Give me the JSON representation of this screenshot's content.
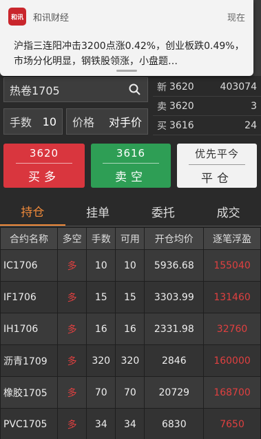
{
  "notification": {
    "app_name": "和讯财经",
    "time": "现在",
    "logo_text": "和讯",
    "body": "沪指三连阳冲击3200点涨0.42%，创业板跌0.49%，市场分化明显，钢铁股领涨，小盘题…"
  },
  "order": {
    "contract": "热卷1705",
    "qty_label": "手数",
    "qty_value": "10",
    "price_label": "价格",
    "price_value": "对手价"
  },
  "quote": {
    "rows": [
      {
        "key": "新",
        "price": "3620",
        "num": "403074"
      },
      {
        "key": "卖",
        "price": "3620",
        "num": "3"
      },
      {
        "key": "买",
        "price": "3616",
        "num": "24"
      }
    ]
  },
  "buttons": {
    "buy_price": "3620",
    "buy_label": "买多",
    "sell_price": "3616",
    "sell_label": "卖空",
    "close_top": "优先平今",
    "close_label": "平仓"
  },
  "tabs": [
    "持仓",
    "挂单",
    "委托",
    "成交"
  ],
  "table": {
    "headers": [
      "合约名称",
      "多空",
      "手数",
      "可用",
      "开仓均价",
      "逐笔浮盈"
    ],
    "rows": [
      [
        "IC1706",
        "多",
        "10",
        "10",
        "5936.68",
        "155040"
      ],
      [
        "IF1706",
        "多",
        "15",
        "15",
        "3303.99",
        "131460"
      ],
      [
        "IH1706",
        "多",
        "16",
        "16",
        "2331.98",
        "32760"
      ],
      [
        "沥青1709",
        "多",
        "320",
        "320",
        "2846",
        "160000"
      ],
      [
        "橡胶1705",
        "多",
        "70",
        "70",
        "20729",
        "168700"
      ],
      [
        "PVC1705",
        "多",
        "34",
        "34",
        "6830",
        "7650"
      ]
    ]
  },
  "colors": {
    "buy": "#d9363e",
    "sell": "#2e9e55",
    "active_tab": "#f08a3a",
    "profit": "#e04040"
  }
}
